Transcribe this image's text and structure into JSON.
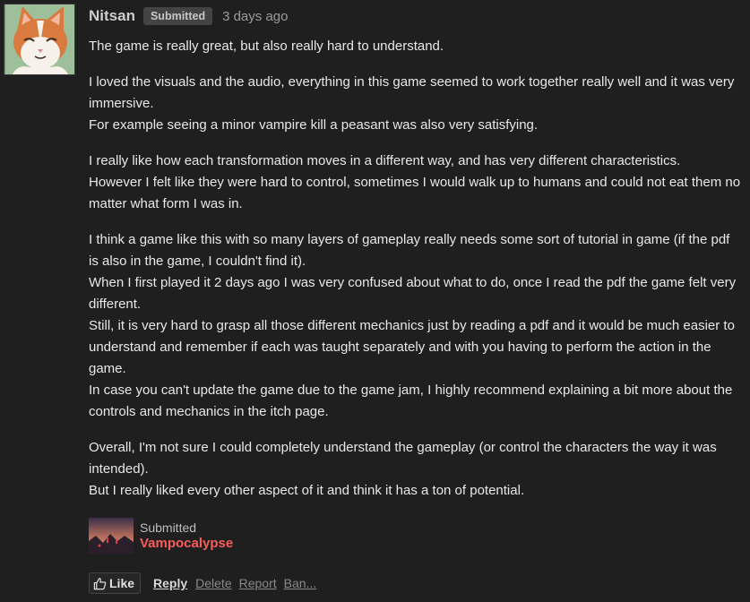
{
  "comment": {
    "author": "Nitsan",
    "badge": "Submitted",
    "time": "3 days ago",
    "avatar_icon": "cat-avatar",
    "paragraphs": [
      "The game is really great, but also really hard to understand.",
      "I loved the visuals and the audio, everything in this game seemed to work together really well and it was very immersive.\nFor example seeing a minor vampire kill a peasant was also very satisfying.",
      "I really like how each transformation moves in a different way, and has very different characteristics.\nHowever I felt like they were hard to control, sometimes I would walk up to humans and could not eat them no matter what form I was in.",
      "I think a game like this with so many layers of gameplay really needs some sort of tutorial in game (if the pdf is also in the game, I couldn't find it).\nWhen I first played it 2 days ago I was very confused about what to do, once I read the pdf the game felt very different.\nStill, it is very hard to grasp all those different mechanics just by reading a pdf and it would be much easier to understand and remember if each was taught separately and with you having to perform the action in the game.\nIn case you can't update the game due to the game jam, I highly recommend explaining a bit more about the controls and mechanics in the itch page.",
      "Overall, I'm not sure I could completely understand the gameplay (or control the characters the way it was intended).\nBut I really liked every other aspect of it and think it has a ton of potential."
    ]
  },
  "submission": {
    "label": "Submitted",
    "game": "Vampocalypse",
    "game_color": "#fa5c5c"
  },
  "actions": {
    "like": "Like",
    "reply": "Reply",
    "delete": "Delete",
    "report": "Report",
    "ban": "Ban..."
  },
  "colors": {
    "background": "#1f1f1f",
    "text": "#e8e8e8",
    "badge_bg": "#434343",
    "accent": "#fa5c5c"
  }
}
